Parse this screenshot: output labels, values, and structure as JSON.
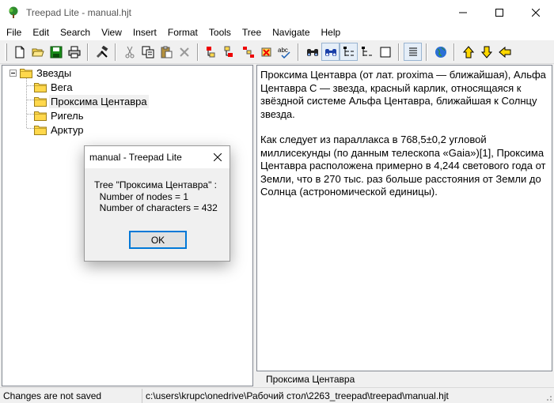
{
  "window": {
    "title": "Treepad Lite - manual.hjt"
  },
  "menu": [
    "File",
    "Edit",
    "Search",
    "View",
    "Insert",
    "Format",
    "Tools",
    "Tree",
    "Navigate",
    "Help"
  ],
  "toolbar": {
    "groups": [
      [
        "new-doc-icon",
        "open-folder-icon",
        "save-icon",
        "print-icon"
      ],
      [
        "tools-icon"
      ],
      [
        "cut-icon",
        "copy-icon",
        "paste-icon",
        "delete-icon"
      ],
      [
        "insert-node-before-icon",
        "insert-node-after-icon",
        "insert-child-icon",
        "delete-node-icon",
        "spellcheck-icon"
      ],
      [
        "find-icon",
        "find-next-icon",
        "tree-view-icon",
        "tree-outline-icon",
        "blank-page-icon"
      ],
      [
        "word-wrap-icon"
      ],
      [
        "globe-icon"
      ],
      [
        "arrow-up-icon",
        "arrow-down-icon",
        "arrow-left-icon"
      ]
    ],
    "spell_label": "abc"
  },
  "tree": {
    "root": "Звезды",
    "children": [
      "Вега",
      "Проксима Центавра",
      "Ригель",
      "Арктур"
    ],
    "selected_index": 1
  },
  "editor": {
    "paragraphs": [
      "Проксима Центавра (от лат. proxima — ближайшая), Альфа Центавра C — звезда, красный карлик, относящаяся к звёздной системе Альфа Центавра, ближайшая к Солнцу звезда.",
      "Как следует из параллакса в 768,5±0,2 угловой миллисекунды (по данным телескопа «Gaia»)[1], Проксима Центавра расположена примерно в 4,244 светового года от Земли, что в 270 тыс. раз больше расстояния от Земли до Солнца (астрономической единицы)."
    ]
  },
  "node_tab": "Проксима Центавра",
  "status": {
    "left": "Changes are not saved",
    "path": "c:\\users\\krupc\\onedrive\\Рабочий стол\\2263_treepad\\treepad\\manual.hjt"
  },
  "dialog": {
    "title": "manual - Treepad Lite",
    "line1": "Tree \"Проксима Центавра\" :",
    "line2": "  Number of nodes = 1",
    "line3": "  Number of characters = 432",
    "ok": "OK"
  },
  "colors": {
    "selection": "#0078d7",
    "folder": "#ffd84c",
    "save_green": "#1a8c1a"
  }
}
